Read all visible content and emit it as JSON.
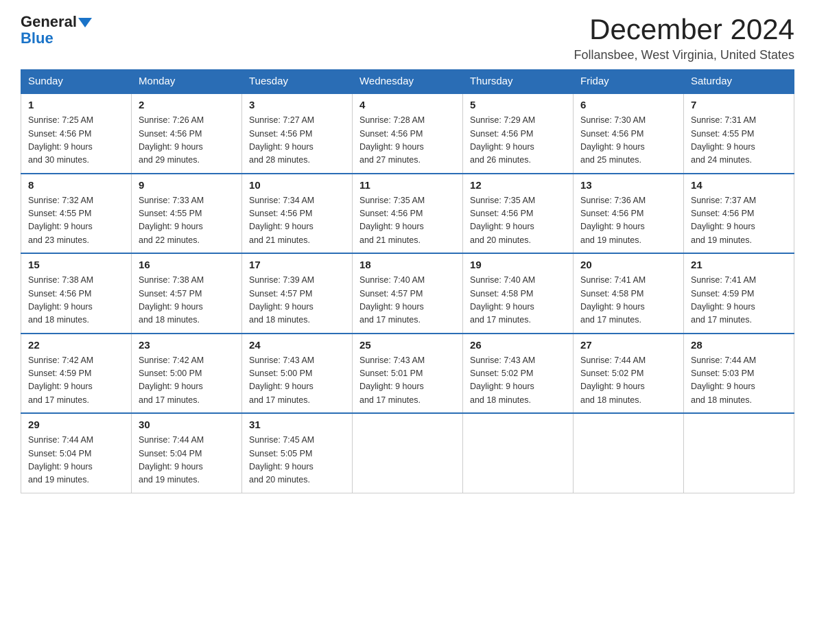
{
  "header": {
    "logo_general": "General",
    "logo_blue": "Blue",
    "month": "December 2024",
    "location": "Follansbee, West Virginia, United States"
  },
  "weekdays": [
    "Sunday",
    "Monday",
    "Tuesday",
    "Wednesday",
    "Thursday",
    "Friday",
    "Saturday"
  ],
  "weeks": [
    [
      {
        "day": "1",
        "sunrise": "7:25 AM",
        "sunset": "4:56 PM",
        "daylight": "9 hours and 30 minutes."
      },
      {
        "day": "2",
        "sunrise": "7:26 AM",
        "sunset": "4:56 PM",
        "daylight": "9 hours and 29 minutes."
      },
      {
        "day": "3",
        "sunrise": "7:27 AM",
        "sunset": "4:56 PM",
        "daylight": "9 hours and 28 minutes."
      },
      {
        "day": "4",
        "sunrise": "7:28 AM",
        "sunset": "4:56 PM",
        "daylight": "9 hours and 27 minutes."
      },
      {
        "day": "5",
        "sunrise": "7:29 AM",
        "sunset": "4:56 PM",
        "daylight": "9 hours and 26 minutes."
      },
      {
        "day": "6",
        "sunrise": "7:30 AM",
        "sunset": "4:56 PM",
        "daylight": "9 hours and 25 minutes."
      },
      {
        "day": "7",
        "sunrise": "7:31 AM",
        "sunset": "4:55 PM",
        "daylight": "9 hours and 24 minutes."
      }
    ],
    [
      {
        "day": "8",
        "sunrise": "7:32 AM",
        "sunset": "4:55 PM",
        "daylight": "9 hours and 23 minutes."
      },
      {
        "day": "9",
        "sunrise": "7:33 AM",
        "sunset": "4:55 PM",
        "daylight": "9 hours and 22 minutes."
      },
      {
        "day": "10",
        "sunrise": "7:34 AM",
        "sunset": "4:56 PM",
        "daylight": "9 hours and 21 minutes."
      },
      {
        "day": "11",
        "sunrise": "7:35 AM",
        "sunset": "4:56 PM",
        "daylight": "9 hours and 21 minutes."
      },
      {
        "day": "12",
        "sunrise": "7:35 AM",
        "sunset": "4:56 PM",
        "daylight": "9 hours and 20 minutes."
      },
      {
        "day": "13",
        "sunrise": "7:36 AM",
        "sunset": "4:56 PM",
        "daylight": "9 hours and 19 minutes."
      },
      {
        "day": "14",
        "sunrise": "7:37 AM",
        "sunset": "4:56 PM",
        "daylight": "9 hours and 19 minutes."
      }
    ],
    [
      {
        "day": "15",
        "sunrise": "7:38 AM",
        "sunset": "4:56 PM",
        "daylight": "9 hours and 18 minutes."
      },
      {
        "day": "16",
        "sunrise": "7:38 AM",
        "sunset": "4:57 PM",
        "daylight": "9 hours and 18 minutes."
      },
      {
        "day": "17",
        "sunrise": "7:39 AM",
        "sunset": "4:57 PM",
        "daylight": "9 hours and 18 minutes."
      },
      {
        "day": "18",
        "sunrise": "7:40 AM",
        "sunset": "4:57 PM",
        "daylight": "9 hours and 17 minutes."
      },
      {
        "day": "19",
        "sunrise": "7:40 AM",
        "sunset": "4:58 PM",
        "daylight": "9 hours and 17 minutes."
      },
      {
        "day": "20",
        "sunrise": "7:41 AM",
        "sunset": "4:58 PM",
        "daylight": "9 hours and 17 minutes."
      },
      {
        "day": "21",
        "sunrise": "7:41 AM",
        "sunset": "4:59 PM",
        "daylight": "9 hours and 17 minutes."
      }
    ],
    [
      {
        "day": "22",
        "sunrise": "7:42 AM",
        "sunset": "4:59 PM",
        "daylight": "9 hours and 17 minutes."
      },
      {
        "day": "23",
        "sunrise": "7:42 AM",
        "sunset": "5:00 PM",
        "daylight": "9 hours and 17 minutes."
      },
      {
        "day": "24",
        "sunrise": "7:43 AM",
        "sunset": "5:00 PM",
        "daylight": "9 hours and 17 minutes."
      },
      {
        "day": "25",
        "sunrise": "7:43 AM",
        "sunset": "5:01 PM",
        "daylight": "9 hours and 17 minutes."
      },
      {
        "day": "26",
        "sunrise": "7:43 AM",
        "sunset": "5:02 PM",
        "daylight": "9 hours and 18 minutes."
      },
      {
        "day": "27",
        "sunrise": "7:44 AM",
        "sunset": "5:02 PM",
        "daylight": "9 hours and 18 minutes."
      },
      {
        "day": "28",
        "sunrise": "7:44 AM",
        "sunset": "5:03 PM",
        "daylight": "9 hours and 18 minutes."
      }
    ],
    [
      {
        "day": "29",
        "sunrise": "7:44 AM",
        "sunset": "5:04 PM",
        "daylight": "9 hours and 19 minutes."
      },
      {
        "day": "30",
        "sunrise": "7:44 AM",
        "sunset": "5:04 PM",
        "daylight": "9 hours and 19 minutes."
      },
      {
        "day": "31",
        "sunrise": "7:45 AM",
        "sunset": "5:05 PM",
        "daylight": "9 hours and 20 minutes."
      },
      null,
      null,
      null,
      null
    ]
  ],
  "labels": {
    "sunrise": "Sunrise:",
    "sunset": "Sunset:",
    "daylight": "Daylight:"
  }
}
